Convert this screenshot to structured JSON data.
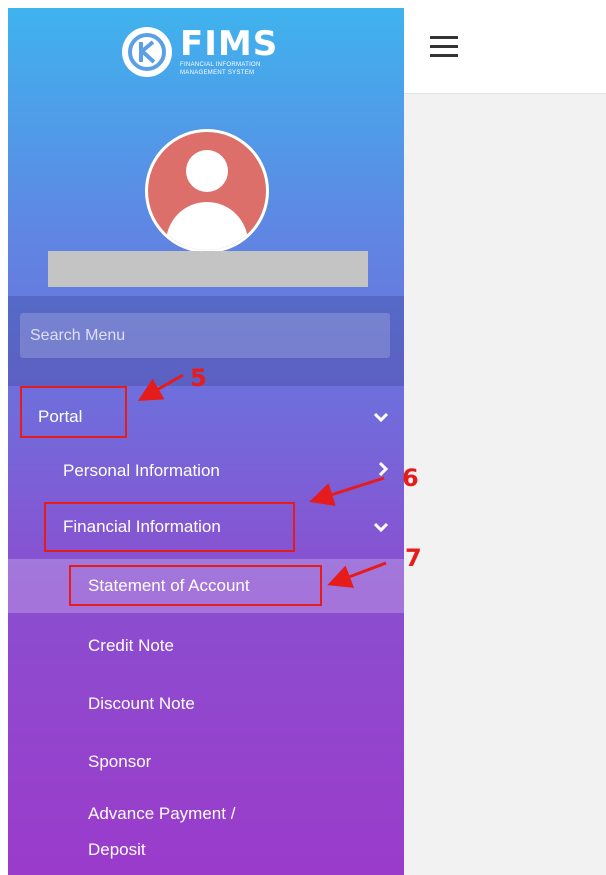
{
  "logo": {
    "title": "FIMS",
    "subtitle": "FINANCIAL INFORMATION MANAGEMENT SYSTEM",
    "icon": "fims-logo-icon"
  },
  "user": {
    "avatar_icon": "user-avatar-icon",
    "name": ""
  },
  "search": {
    "placeholder": "Search Menu"
  },
  "menu": {
    "portal": "Portal",
    "personal_information": "Personal Information",
    "financial_information": "Financial Information",
    "statement_of_account": "Statement of Account",
    "credit_note": "Credit Note",
    "discount_note": "Discount Note",
    "sponsor": "Sponsor",
    "advance_payment_line1": "Advance Payment /",
    "advance_payment_line2": "Deposit"
  },
  "header": {
    "menu_icon": "hamburger-menu-icon"
  },
  "annotations": {
    "n5": "5",
    "n6": "6",
    "n7": "7"
  },
  "colors": {
    "annotation": "#e61c1c",
    "sidebar_top": "#3fb3ee",
    "sidebar_bottom": "#9b3bcb",
    "avatar": "#dd6f6a"
  }
}
